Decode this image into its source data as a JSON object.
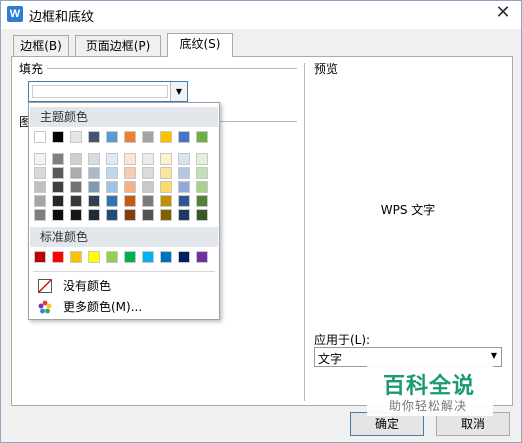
{
  "window": {
    "title": "边框和底纹",
    "app_icon_letter": "W"
  },
  "tabs": [
    {
      "label": "边框(B)",
      "active": false
    },
    {
      "label": "页面边框(P)",
      "active": false
    },
    {
      "label": "底纹(S)",
      "active": true
    }
  ],
  "fill": {
    "group_label": "填充",
    "current_color": "#ffffff"
  },
  "pattern": {
    "label_partial": "图"
  },
  "preview": {
    "group_label": "预览",
    "sample_text": "WPS 文字"
  },
  "apply_to": {
    "label": "应用于(L):",
    "value": "文字"
  },
  "buttons": {
    "ok": "确定",
    "cancel": "取消"
  },
  "color_dropdown": {
    "theme_label": "主题颜色",
    "standard_label": "标准颜色",
    "theme_top_row": [
      "#ffffff",
      "#000000",
      "#e7e6e6",
      "#44546a",
      "#5b9bd5",
      "#ed7d31",
      "#a5a5a5",
      "#ffc000",
      "#4472c4",
      "#70ad47"
    ],
    "theme_shades": [
      [
        "#f2f2f2",
        "#7f7f7f",
        "#d0cece",
        "#d6dce5",
        "#deebf7",
        "#fbe5d6",
        "#ededed",
        "#fff2cc",
        "#dae3f3",
        "#e2f0d9"
      ],
      [
        "#d9d9d9",
        "#595959",
        "#aeabab",
        "#adb9ca",
        "#bdd7ee",
        "#f8cbad",
        "#dbdbdb",
        "#ffe699",
        "#b4c7e7",
        "#c5e0b4"
      ],
      [
        "#bfbfbf",
        "#3f3f3f",
        "#757171",
        "#8497b0",
        "#9dc3e6",
        "#f4b183",
        "#c9c9c9",
        "#ffd966",
        "#8faadc",
        "#a9d18e"
      ],
      [
        "#a6a6a6",
        "#262626",
        "#3a3838",
        "#333f50",
        "#2e75b6",
        "#c55a11",
        "#7b7b7b",
        "#bf9000",
        "#2f5597",
        "#538135"
      ],
      [
        "#7f7f7f",
        "#0d0d0d",
        "#171616",
        "#222a35",
        "#1f4e79",
        "#843c0c",
        "#525252",
        "#7f6000",
        "#203864",
        "#385723"
      ]
    ],
    "standard_colors": [
      "#c00000",
      "#ff0000",
      "#ffc000",
      "#ffff00",
      "#92d050",
      "#00b050",
      "#00b0f0",
      "#0070c0",
      "#002060",
      "#7030a0"
    ],
    "no_color_label": "没有颜色",
    "more_colors_label": "更多颜色(M)...",
    "no_color_icon": "no-color-icon",
    "more_colors_icon": "color-wheel-icon"
  },
  "watermark": {
    "title": "百科全说",
    "subtitle": "助你轻松解决"
  }
}
